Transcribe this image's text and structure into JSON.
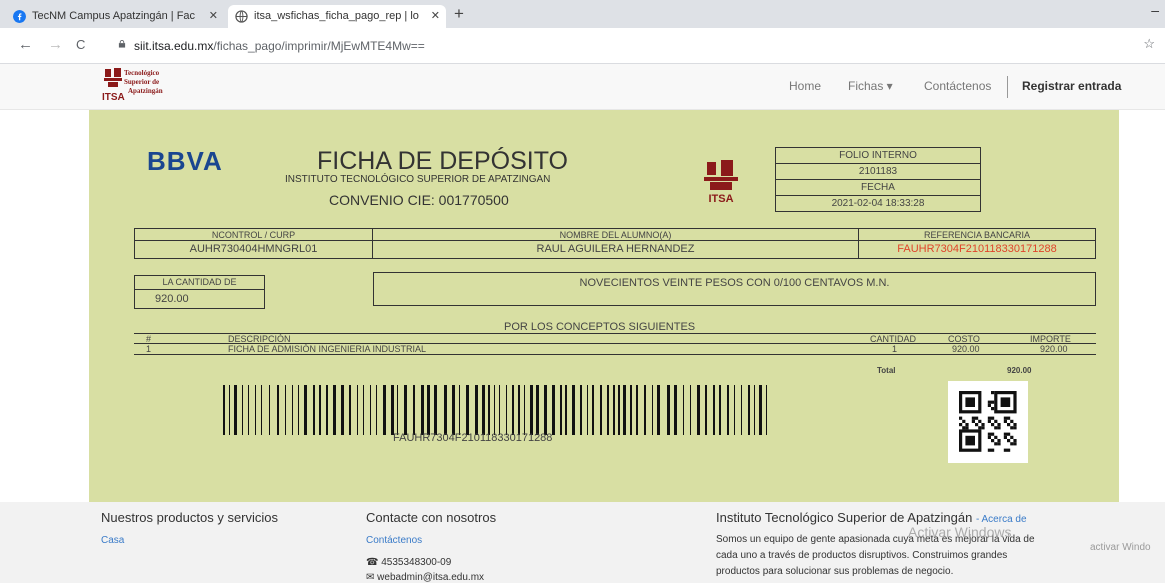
{
  "browser": {
    "tabs": [
      {
        "title": "TecNM Campus Apatzingán | Fac",
        "active": false,
        "close": "✕"
      },
      {
        "title": "itsa_wsfichas_ficha_pago_rep | lo",
        "active": true,
        "close": "✕"
      }
    ],
    "new_tab": "+",
    "minimize": "–",
    "back": "←",
    "forward": "→",
    "reload": "C",
    "url_host": "siit.itsa.edu.mx",
    "url_path": "/fichas_pago/imprimir/MjEwMTE4Mw==",
    "bookmark": "☆"
  },
  "site_nav": {
    "logo_text": [
      "Tecnológico",
      "Superior de",
      "Apatzingán"
    ],
    "logo_itsa": "ITSA",
    "links": [
      "Home",
      "Fichas ▾",
      "Contáctenos"
    ],
    "login": "Registrar entrada"
  },
  "ficha": {
    "bank": "BBVA",
    "title": "FICHA DE DEPÓSITO",
    "institution": "INSTITUTO TECNOLÓGICO SUPERIOR DE APATZINGAN",
    "convenio": "CONVENIO CIE: 001770500",
    "itsa_logo": "ITSA",
    "folio_label": "FOLIO INTERNO",
    "folio": "2101183",
    "fecha_label": "FECHA",
    "fecha": "2021-02-04 18:33:28",
    "ncontrol_label": "NCONTROL / CURP",
    "ncontrol": "AUHR730404HMNGRL01",
    "alumno_label": "NOMBRE DEL ALUMNO(A)",
    "alumno": "RAUL AGUILERA HERNANDEZ",
    "referencia_label": "REFERENCIA BANCARIA",
    "referencia": "FAUHR7304F210118330171288",
    "cantidad_label": "LA CANTIDAD DE",
    "cantidad": "920.00",
    "cantidad_letras": "NOVECIENTOS VEINTE PESOS CON 0/100 CENTAVOS M.N.",
    "conceptos_title": "POR LOS CONCEPTOS SIGUIENTES",
    "conceptos_headers": {
      "num": "#",
      "desc": "DESCRIPCIÓN",
      "cant": "CANTIDAD",
      "costo": "COSTO",
      "importe": "IMPORTE"
    },
    "conceptos_rows": [
      {
        "num": "1",
        "desc": "FICHA DE ADMISIÓN INGENIERIA INDUSTRIAL",
        "cant": "1",
        "costo": "920.00",
        "importe": "920.00"
      }
    ],
    "total_label": "Total",
    "total": "920.00",
    "barcode_text": "FAUHR7304F210118330171288"
  },
  "footer": {
    "col1_title": "Nuestros productos y servicios",
    "col1_link": "Casa",
    "col2_title": "Contacte con nosotros",
    "col2_link": "Contáctenos",
    "phone": "4535348300-09",
    "email": "webadmin@itsa.edu.mx",
    "col3_title": "Instituto Tecnológico Superior de Apatzingán",
    "col3_link": "- Acerca de",
    "col3_text1": "Somos un equipo de gente apasionada cuya meta es mejorar la vida de",
    "col3_text2": "cada uno a través de productos disruptivos. Construimos grandes",
    "col3_text3": "productos para solucionar sus problemas de negocio.",
    "watermark": "Activar Windows",
    "watermark2": "activar Windo"
  },
  "colors": {
    "panel": "#d8dfa3",
    "bbva": "#1a4690",
    "reference": "#e0442a",
    "link": "#3a7bc8"
  }
}
